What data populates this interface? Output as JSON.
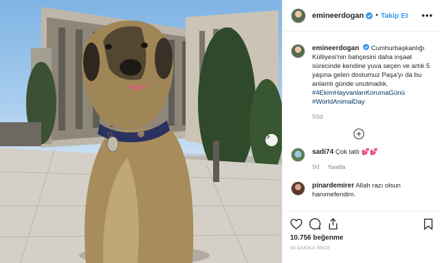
{
  "post": {
    "username": "emineerdogan",
    "follow_label": "Takip Et",
    "separator": "•",
    "more_label": "•••",
    "caption": {
      "username": "emineerdogan",
      "text": "Cumhurbaşkanlığı Külliyesi'nin bahçesini daha inşaat sürecinde kendine yuva seçen ve artık 5 yaşına gelen dostumuz Paşa'yı da bu anlamlı günde unutmadık.",
      "hashtags": [
        "#4EkimHayvanlarıKorumaGünü",
        "#WorldAnimalDay"
      ],
      "age": "59d"
    },
    "comments": [
      {
        "username": "sadi74",
        "text": "Çok tatlı 💕💕",
        "age": "9d",
        "reply_label": "Yanıtla"
      },
      {
        "username": "pinardemirer",
        "text": "Allah razı olsun hanımefendim."
      }
    ],
    "likes": "10.756 beğenme",
    "timestamp": "59 DAKİKA ÖNCE"
  },
  "icons": {
    "verified": "verified-badge-icon",
    "load_more": "plus-circle-icon",
    "like": "heart-icon",
    "comment": "comment-icon",
    "share": "share-icon",
    "save": "bookmark-icon",
    "next": "chevron-right-icon"
  },
  "colors": {
    "accent": "#3897f0",
    "hashtag": "#003569",
    "muted": "#999999",
    "text": "#262626"
  }
}
